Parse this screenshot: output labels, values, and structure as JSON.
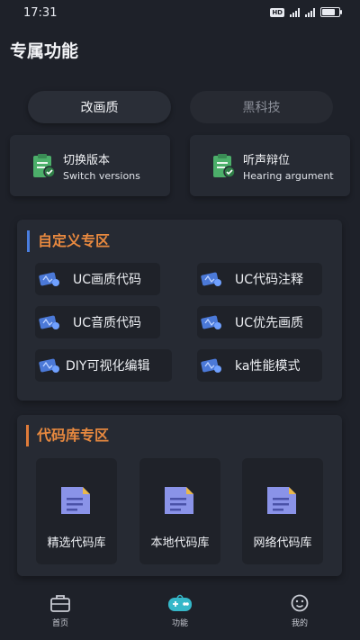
{
  "status": {
    "time": "17:31",
    "hd": "HD"
  },
  "page": {
    "title": "专属功能"
  },
  "segments": [
    {
      "label": "改画质",
      "active": true
    },
    {
      "label": "黑科技",
      "active": false
    }
  ],
  "features": [
    {
      "title": "切换版本",
      "subtitle": "Switch versions",
      "icon": "clipboard-check-icon"
    },
    {
      "title": "听声辩位",
      "subtitle": "Hearing argument",
      "icon": "clipboard-check-icon"
    }
  ],
  "custom_section": {
    "title": "自定义专区",
    "items": [
      {
        "label": "UC画质代码",
        "icon": "code-card-icon"
      },
      {
        "label": "UC代码注释",
        "icon": "code-card-icon"
      },
      {
        "label": "UC音质代码",
        "icon": "code-card-icon"
      },
      {
        "label": "UC优先画质",
        "icon": "code-card-icon"
      },
      {
        "label": "DIY可视化编辑",
        "icon": "code-card-icon"
      },
      {
        "label": "ka性能模式",
        "icon": "code-card-icon"
      }
    ]
  },
  "library_section": {
    "title": "代码库专区",
    "items": [
      {
        "label": "精选代码库",
        "icon": "document-icon"
      },
      {
        "label": "本地代码库",
        "icon": "document-icon"
      },
      {
        "label": "网络代码库",
        "icon": "document-icon"
      }
    ]
  },
  "tabbar": [
    {
      "label": "首页",
      "icon": "briefcase-icon"
    },
    {
      "label": "功能",
      "icon": "gamepad-icon"
    },
    {
      "label": "我的",
      "icon": "smile-face-icon"
    }
  ],
  "colors": {
    "background": "#1e2129",
    "card": "#262a33",
    "accent_orange": "#e8893f",
    "accent_blue": "#4a7ee0",
    "icon_green": "#4caf6a"
  }
}
